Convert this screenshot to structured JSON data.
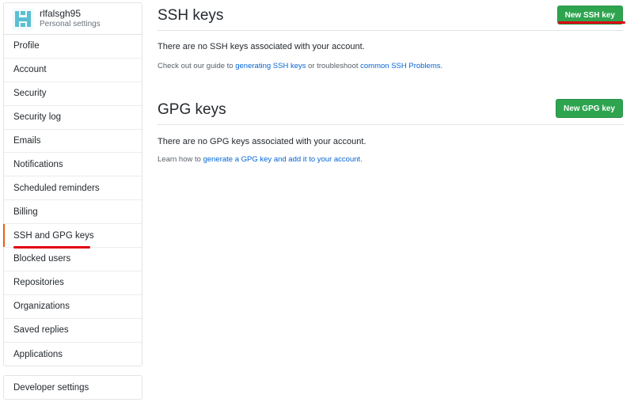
{
  "profile": {
    "username": "rlfalsgh95",
    "subtitle": "Personal settings"
  },
  "sidebar": {
    "items": [
      {
        "label": "Profile"
      },
      {
        "label": "Account"
      },
      {
        "label": "Security"
      },
      {
        "label": "Security log"
      },
      {
        "label": "Emails"
      },
      {
        "label": "Notifications"
      },
      {
        "label": "Scheduled reminders"
      },
      {
        "label": "Billing"
      },
      {
        "label": "SSH and GPG keys",
        "selected": true
      },
      {
        "label": "Blocked users"
      },
      {
        "label": "Repositories"
      },
      {
        "label": "Organizations"
      },
      {
        "label": "Saved replies"
      },
      {
        "label": "Applications"
      }
    ],
    "developer_settings": "Developer settings"
  },
  "ssh": {
    "title": "SSH keys",
    "button": "New SSH key",
    "empty_message": "There are no SSH keys associated with your account.",
    "note_prefix": "Check out our guide to ",
    "note_link1": "generating SSH keys",
    "note_middle": " or troubleshoot ",
    "note_link2": "common SSH Problems",
    "note_suffix": "."
  },
  "gpg": {
    "title": "GPG keys",
    "button": "New GPG key",
    "empty_message": "There are no GPG keys associated with your account.",
    "note_prefix": "Learn how to ",
    "note_link": "generate a GPG key and add it to your account",
    "note_suffix": "."
  },
  "colors": {
    "accent_selected": "#e36209",
    "button_green": "#2ea44f",
    "link_blue": "#0366d6",
    "annotation_red": "#e00010"
  }
}
